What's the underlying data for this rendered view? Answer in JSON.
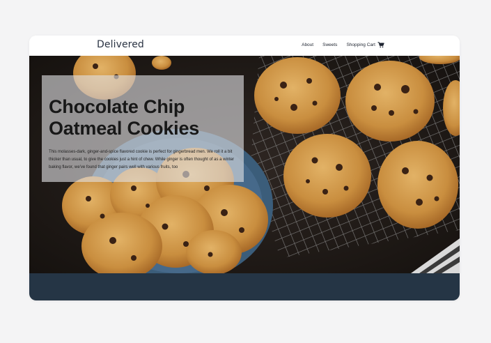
{
  "brand": {
    "name": "Delivered"
  },
  "nav": {
    "about": "About",
    "sweets": "Sweets",
    "cart": "Shopping Cart",
    "cart_icon": "shopping-cart-icon"
  },
  "hero": {
    "title": "Chocolate Chip Oatmeal Cookies",
    "description": "This molasses-dark, ginger-and-spice flavored cookie is perfect for gingerbread men. We roll it a bit thicker than usual, to give the cookies just a hint of chew. While ginger is often thought of as a winter baking flavor, we've found that ginger pairs well with various fruits, too"
  },
  "colors": {
    "background": "#f4f4f5",
    "footer": "#253545",
    "brand_text": "#2a3343"
  }
}
